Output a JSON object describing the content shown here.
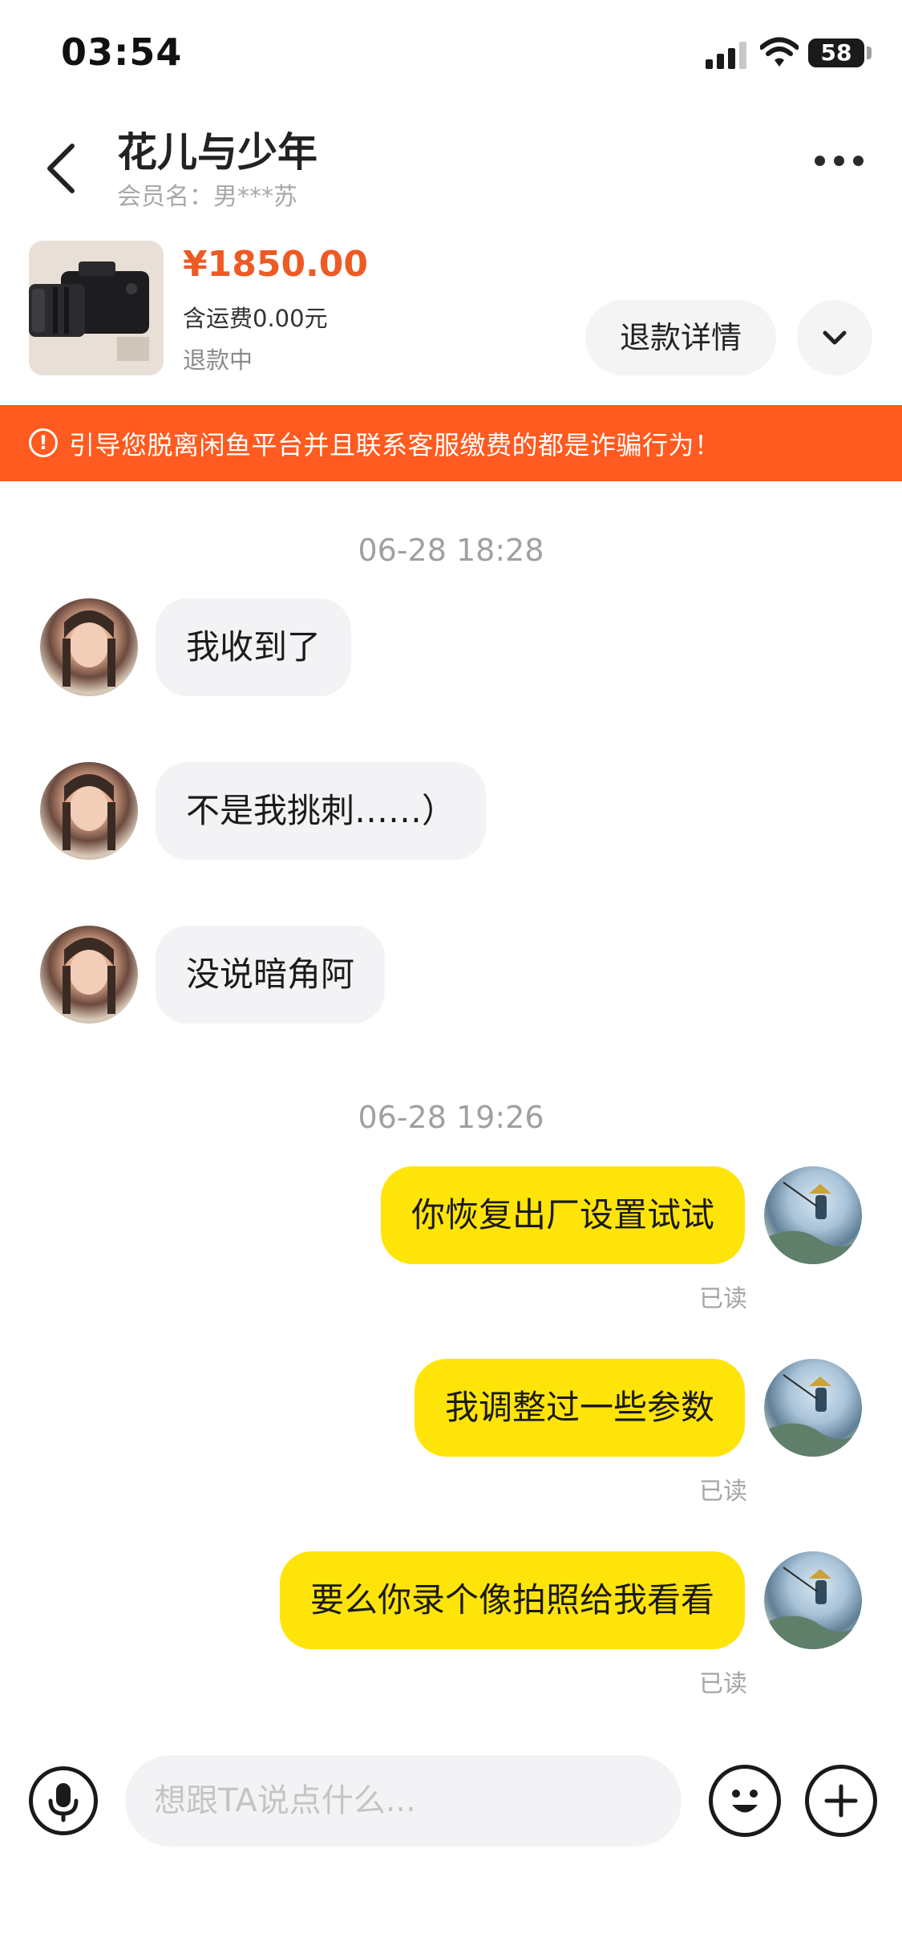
{
  "status_bar": {
    "time": "03:54",
    "battery": "58",
    "battery_level": 0.58
  },
  "header": {
    "title": "花儿与少年",
    "member": "会员名：男***苏"
  },
  "product": {
    "image": "camera-photo",
    "price": "¥1850.00",
    "shipping": "含运费0.00元",
    "status": "退款中",
    "refund_button": "退款详情"
  },
  "banner": {
    "icon": "!",
    "text": "引导您脱离闲鱼平台并且联系客服缴费的都是诈骗行为！",
    "color": "#ff5a1f"
  },
  "messages": {
    "ts1": "06-28 18:28",
    "m1": "我收到了",
    "m2": "不是我挑刺……）",
    "m3": "没说暗角阿",
    "ts2": "06-28 19:26",
    "m4": "你恢复出厂设置试试",
    "m5": "我调整过一些参数",
    "m6": "要么你录个像拍照给我看看",
    "read": "已读"
  },
  "input": {
    "placeholder": "想跟TA说点什么..."
  },
  "colors": {
    "accent": "#ee5a24",
    "outgoing_bubble": "#ffe40a",
    "incoming_bubble": "#f3f3f5"
  }
}
